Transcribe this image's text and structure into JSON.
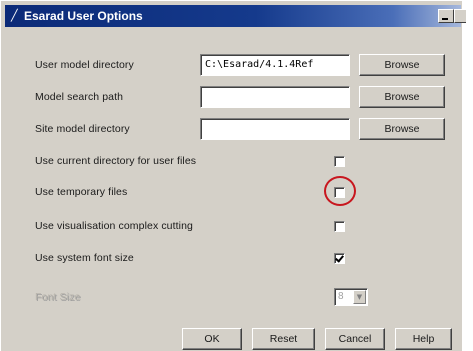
{
  "window": {
    "title": "Esarad User Options"
  },
  "fields": [
    {
      "label": "User model directory",
      "value": "C:\\Esarad/4.1.4Ref",
      "button": "Browse"
    },
    {
      "label": "Model search path",
      "value": "",
      "button": "Browse"
    },
    {
      "label": "Site model directory",
      "value": "",
      "button": "Browse"
    }
  ],
  "options": [
    {
      "label": "Use current directory for user files",
      "checked": false
    },
    {
      "label": "Use temporary files",
      "checked": false
    },
    {
      "label": "Use visualisation complex cutting",
      "checked": false
    },
    {
      "label": "Use system font size",
      "checked": true
    }
  ],
  "font_size": {
    "label": "Font Size",
    "value": "8",
    "disabled": true
  },
  "buttons": {
    "ok": "OK",
    "reset": "Reset",
    "cancel": "Cancel",
    "help": "Help"
  },
  "highlight": {
    "target": "Use temporary files",
    "color": "#c8161e"
  },
  "colors": {
    "titlebar": "#0b2a78",
    "face": "#d4d0c8"
  }
}
